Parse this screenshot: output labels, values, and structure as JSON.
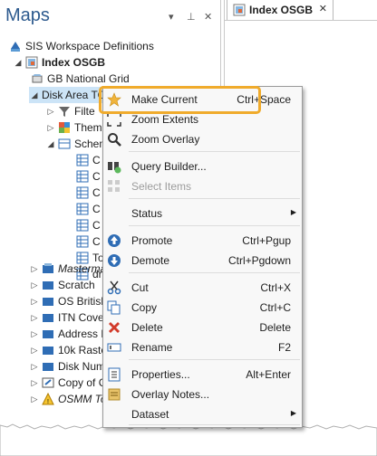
{
  "maps_pane": {
    "title": "Maps",
    "buttons": {
      "dropdown": "▾",
      "pin": "⊥",
      "close": "✕"
    },
    "tree": {
      "root": "SIS Workspace Definitions",
      "index": "Index OSGB",
      "gb_grid": "GB National Grid",
      "disk_area": "Disk Area TOPO",
      "filter": "Filte",
      "theme": "Them",
      "schema": "Schem",
      "schema_children": [
        "C",
        "C",
        "C",
        "C",
        "C",
        "C",
        "To",
        "dr"
      ],
      "others": [
        {
          "label": "Masterma",
          "italic": true
        },
        {
          "label": "Scratch",
          "italic": false
        },
        {
          "label": "OS British",
          "italic": false
        },
        {
          "label": "ITN Cove",
          "italic": false
        },
        {
          "label": "Address L",
          "italic": false
        },
        {
          "label": "10k Raste",
          "italic": false
        },
        {
          "label": "Disk Numb",
          "italic": false
        },
        {
          "label": "Copy of C",
          "italic": false
        },
        {
          "label": "OSMM To",
          "italic": true
        }
      ]
    }
  },
  "doc_tab": {
    "label": "Index OSGB",
    "close": "✕"
  },
  "menu": {
    "items": [
      {
        "label": "Make Current",
        "shortcut": "Ctrl+Space",
        "icon": "star-icon"
      },
      {
        "label": "Zoom Extents",
        "shortcut": "",
        "icon": "zoom-extents-icon"
      },
      {
        "label": "Zoom Overlay",
        "shortcut": "",
        "icon": "magnifier-icon"
      },
      {
        "label": "Query Builder...",
        "shortcut": "",
        "icon": "query-builder-icon"
      },
      {
        "label": "Select Items",
        "shortcut": "",
        "icon": "select-items-icon"
      },
      {
        "label": "Status",
        "shortcut": "",
        "icon": ""
      },
      {
        "label": "Promote",
        "shortcut": "Ctrl+Pgup",
        "icon": "promote-icon"
      },
      {
        "label": "Demote",
        "shortcut": "Ctrl+Pgdown",
        "icon": "demote-icon"
      },
      {
        "label": "Cut",
        "shortcut": "Ctrl+X",
        "icon": "scissors-icon"
      },
      {
        "label": "Copy",
        "shortcut": "Ctrl+C",
        "icon": "copy-icon"
      },
      {
        "label": "Delete",
        "shortcut": "Delete",
        "icon": "delete-icon"
      },
      {
        "label": "Rename",
        "shortcut": "F2",
        "icon": "rename-icon"
      },
      {
        "label": "Properties...",
        "shortcut": "Alt+Enter",
        "icon": "properties-icon"
      },
      {
        "label": "Overlay Notes...",
        "shortcut": "",
        "icon": "notes-icon"
      },
      {
        "label": "Dataset",
        "shortcut": "",
        "icon": ""
      }
    ],
    "submenu_arrow": "▶"
  },
  "colors": {
    "title": "#2d5a8e",
    "highlight": "#f0ab2c",
    "blue_icon": "#2f6db5",
    "red": "#d23a2a"
  }
}
